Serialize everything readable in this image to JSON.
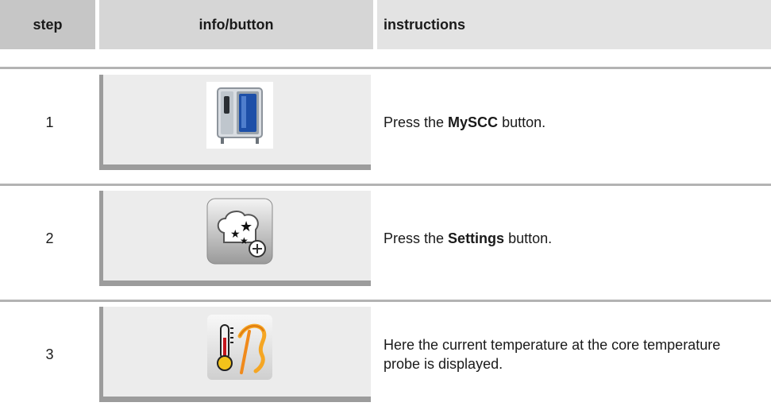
{
  "header": {
    "step": "step",
    "info": "info/button",
    "instructions": "instructions"
  },
  "rows": [
    {
      "step": "1",
      "icon": "myscc-icon",
      "instr_before": "Press the ",
      "instr_bold": "MySCC",
      "instr_after": " button."
    },
    {
      "step": "2",
      "icon": "settings-icon",
      "instr_before": "Press the ",
      "instr_bold": "Settings",
      "instr_after": " button."
    },
    {
      "step": "3",
      "icon": "core-temperature-probe-icon",
      "instr_before": "Here the current temperature at the core temperature probe is displayed.",
      "instr_bold": "",
      "instr_after": ""
    }
  ]
}
